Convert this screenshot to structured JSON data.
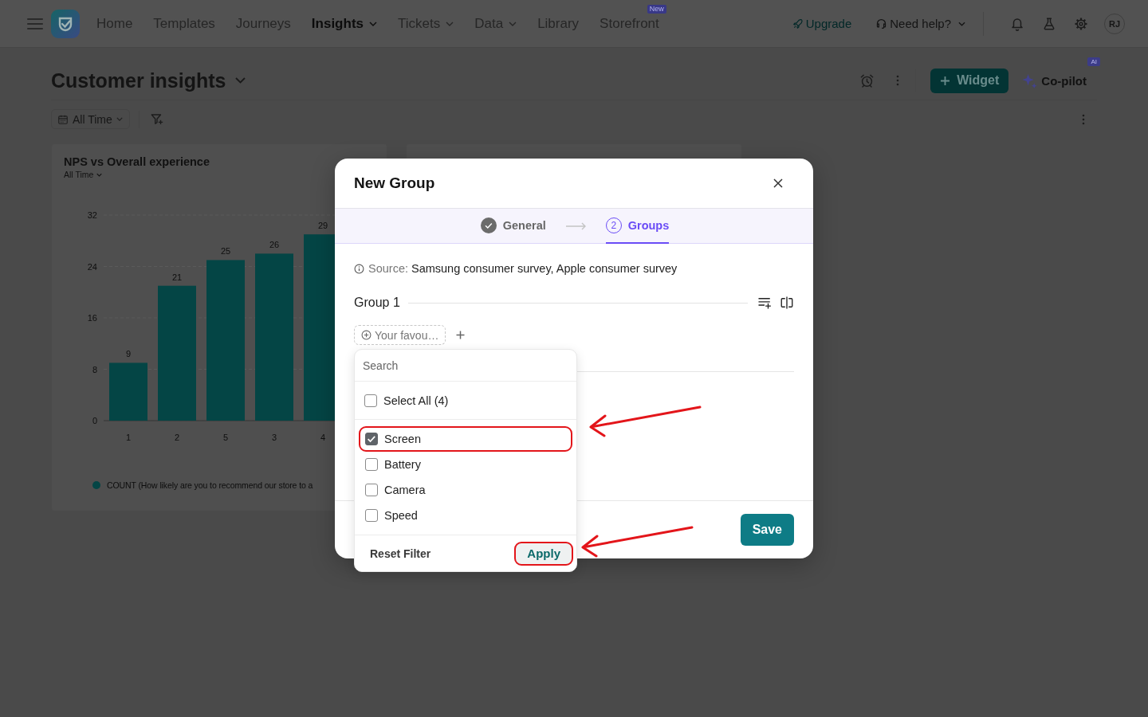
{
  "nav": {
    "items": [
      {
        "label": "Home",
        "selected": false,
        "has_menu": false
      },
      {
        "label": "Templates",
        "selected": false,
        "has_menu": false
      },
      {
        "label": "Journeys",
        "selected": false,
        "has_menu": false
      },
      {
        "label": "Insights",
        "selected": true,
        "has_menu": true
      },
      {
        "label": "Tickets",
        "selected": false,
        "has_menu": true
      },
      {
        "label": "Data",
        "selected": false,
        "has_menu": true
      },
      {
        "label": "Library",
        "selected": false,
        "has_menu": false
      },
      {
        "label": "Storefront",
        "selected": false,
        "has_menu": false,
        "badge": "New"
      }
    ],
    "upgrade": "Upgrade",
    "help": "Need help?",
    "avatar": "RJ"
  },
  "header": {
    "title": "Customer insights",
    "widget_button": "Widget",
    "copilot": {
      "label": "Co-pilot",
      "badge": "AI"
    }
  },
  "filters": {
    "date_range": "All Time"
  },
  "nps_card": {
    "title": "NPS vs Overall experience",
    "subtitle": "All Time",
    "chart_data": {
      "type": "bar",
      "categories": [
        "1",
        "2",
        "5",
        "3",
        "4"
      ],
      "series": [
        {
          "name": "COUNT (How likely are you to recommend our store to a",
          "color": "#044545",
          "values": [
            9,
            21,
            25,
            26,
            29
          ]
        }
      ],
      "ylim": [
        0,
        32
      ],
      "yticks": [
        0,
        8,
        16,
        24,
        32
      ],
      "data_labels": true
    }
  },
  "modal": {
    "title": "New Group",
    "steps": [
      {
        "label": "General",
        "done": true,
        "selected": false
      },
      {
        "number": "2",
        "label": "Groups",
        "done": false,
        "selected": true
      }
    ],
    "source_label": "Source:",
    "source": "Samsung consumer survey, Apple consumer survey",
    "group": {
      "title": "Group 1",
      "chip": "Your favou…"
    },
    "save_button": "Save"
  },
  "dropdown": {
    "search": {
      "placeholder": "Search"
    },
    "select_all": {
      "label": "Select All (4)",
      "checked": false
    },
    "options": [
      {
        "label": "Screen",
        "checked": true,
        "highlighted": true
      },
      {
        "label": "Battery",
        "checked": false,
        "highlighted": false
      },
      {
        "label": "Camera",
        "checked": false,
        "highlighted": false
      },
      {
        "label": "Speed",
        "checked": false,
        "highlighted": false
      }
    ],
    "reset_button": "Reset Filter",
    "apply_button": {
      "label": "Apply",
      "highlighted": true
    }
  }
}
